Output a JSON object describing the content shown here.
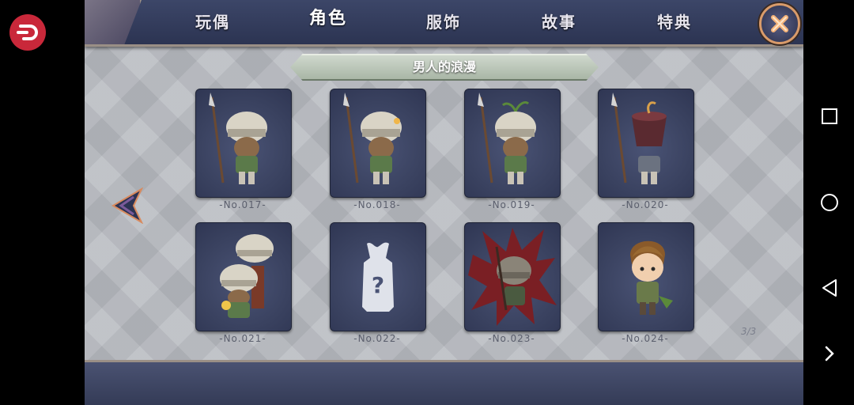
{
  "tabs": [
    {
      "label": "玩偶",
      "active": false
    },
    {
      "label": "角色",
      "active": true
    },
    {
      "label": "服饰",
      "active": false
    },
    {
      "label": "故事",
      "active": false
    },
    {
      "label": "特典",
      "active": false
    }
  ],
  "section_title": "男人的浪漫",
  "cards": [
    {
      "label": "-No.017-",
      "character": "armored-spear-soldier"
    },
    {
      "label": "-No.018-",
      "character": "armored-spear-soldier-flower"
    },
    {
      "label": "-No.019-",
      "character": "armored-spear-soldier-sprout"
    },
    {
      "label": "-No.020-",
      "character": "soldier-with-pot-helmet"
    },
    {
      "label": "-No.021-",
      "character": "two-armored-soldiers-with-flower"
    },
    {
      "label": "-No.022-",
      "character": "locked-unknown"
    },
    {
      "label": "-No.023-",
      "character": "soldier-red-aura"
    },
    {
      "label": "-No.024-",
      "character": "brown-haired-boy"
    }
  ],
  "page_indicator": "3/3",
  "colors": {
    "accent": "#d99b6a",
    "panel": "#3a4260",
    "close_button": "#2a2f4a"
  }
}
